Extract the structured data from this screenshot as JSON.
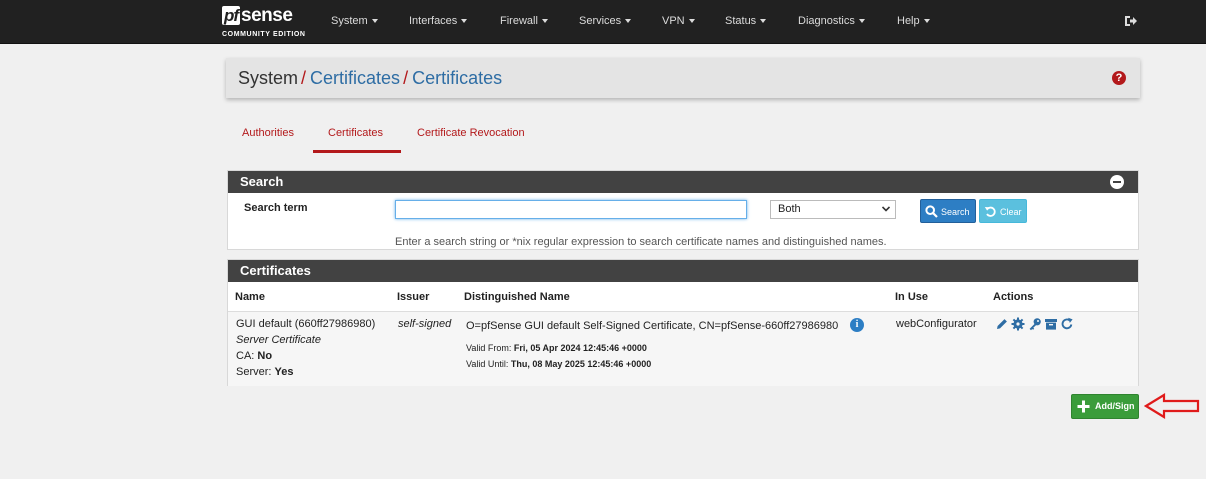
{
  "brand": {
    "pf": "pf",
    "sense": "sense",
    "edition": "COMMUNITY EDITION"
  },
  "nav": [
    {
      "label": "System"
    },
    {
      "label": "Interfaces"
    },
    {
      "label": "Firewall"
    },
    {
      "label": "Services"
    },
    {
      "label": "VPN"
    },
    {
      "label": "Status"
    },
    {
      "label": "Diagnostics"
    },
    {
      "label": "Help"
    }
  ],
  "breadcrumb": {
    "root": "System",
    "sep": "/",
    "level1": "Certificates",
    "level2": "Certificates"
  },
  "help_icon": "?",
  "tabs": [
    {
      "label": "Authorities"
    },
    {
      "label": "Certificates"
    },
    {
      "label": "Certificate Revocation"
    }
  ],
  "search_panel": {
    "title": "Search",
    "term_label": "Search term",
    "term_value": "",
    "scope_selected": "Both",
    "search_button": "Search",
    "clear_button": "Clear",
    "help_text": "Enter a search string or *nix regular expression to search certificate names and distinguished names."
  },
  "cert_panel": {
    "title": "Certificates",
    "columns": {
      "name": "Name",
      "issuer": "Issuer",
      "dn": "Distinguished Name",
      "in_use": "In Use",
      "actions": "Actions"
    },
    "rows": [
      {
        "name": "GUI default (660ff27986980)",
        "type": "Server Certificate",
        "ca_label": "CA:",
        "ca_value": "No",
        "server_label": "Server:",
        "server_value": "Yes",
        "issuer": "self-signed",
        "dn": "O=pfSense GUI default Self-Signed Certificate, CN=pfSense-660ff27986980",
        "valid_from_label": "Valid From:",
        "valid_from": "Fri, 05 Apr 2024 12:45:46 +0000",
        "valid_until_label": "Valid Until:",
        "valid_until": "Thu, 08 May 2025 12:45:46 +0000",
        "info_icon": "i",
        "in_use": "webConfigurator",
        "actions": [
          "pencil-icon",
          "cog-icon",
          "key-icon",
          "archive-icon",
          "refresh-icon"
        ]
      }
    ]
  },
  "add_button": "Add/Sign",
  "colors": {
    "navbar": "#212121",
    "accent_red": "#b3191b",
    "link_blue": "#2e6da4",
    "panel_heading": "#424242",
    "success": "#3a9c3a",
    "info": "#5bc0de",
    "primary": "#2d7ec4"
  }
}
